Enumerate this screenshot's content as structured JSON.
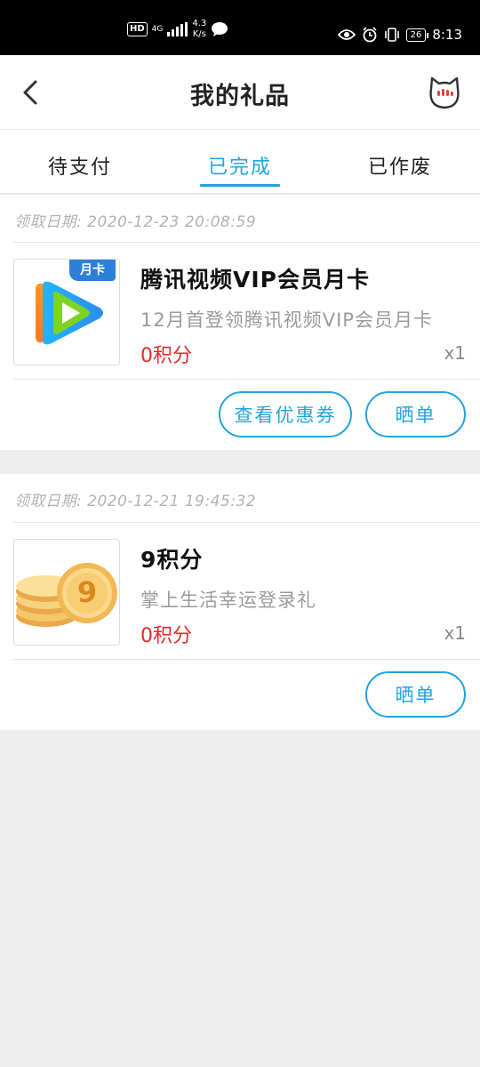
{
  "status_bar": {
    "hd": "HD",
    "network": "4G",
    "speed_value": "4.3",
    "speed_unit": "K/s",
    "battery": "26",
    "time": "8:13"
  },
  "header": {
    "title": "我的礼品"
  },
  "tabs": [
    {
      "label": "待支付",
      "active": false
    },
    {
      "label": "已完成",
      "active": true
    },
    {
      "label": "已作废",
      "active": false
    }
  ],
  "orders": [
    {
      "date": "领取日期: 2020-12-23 20:08:59",
      "badge": "月卡",
      "title": "腾讯视频VIP会员月卡",
      "description": "12月首登领腾讯视频VIP会员月卡",
      "price": "0积分",
      "quantity": "x1",
      "buttons": [
        "查看优惠券",
        "晒单"
      ]
    },
    {
      "date": "领取日期: 2020-12-21 19:45:32",
      "coin_number": "9",
      "title": "9积分",
      "description": "掌上生活幸运登录礼",
      "price": "0积分",
      "quantity": "x1",
      "buttons": [
        "晒单"
      ]
    }
  ],
  "colors": {
    "accent": "#23a4de",
    "price": "#e02a2a",
    "background": "#eeeeee"
  }
}
